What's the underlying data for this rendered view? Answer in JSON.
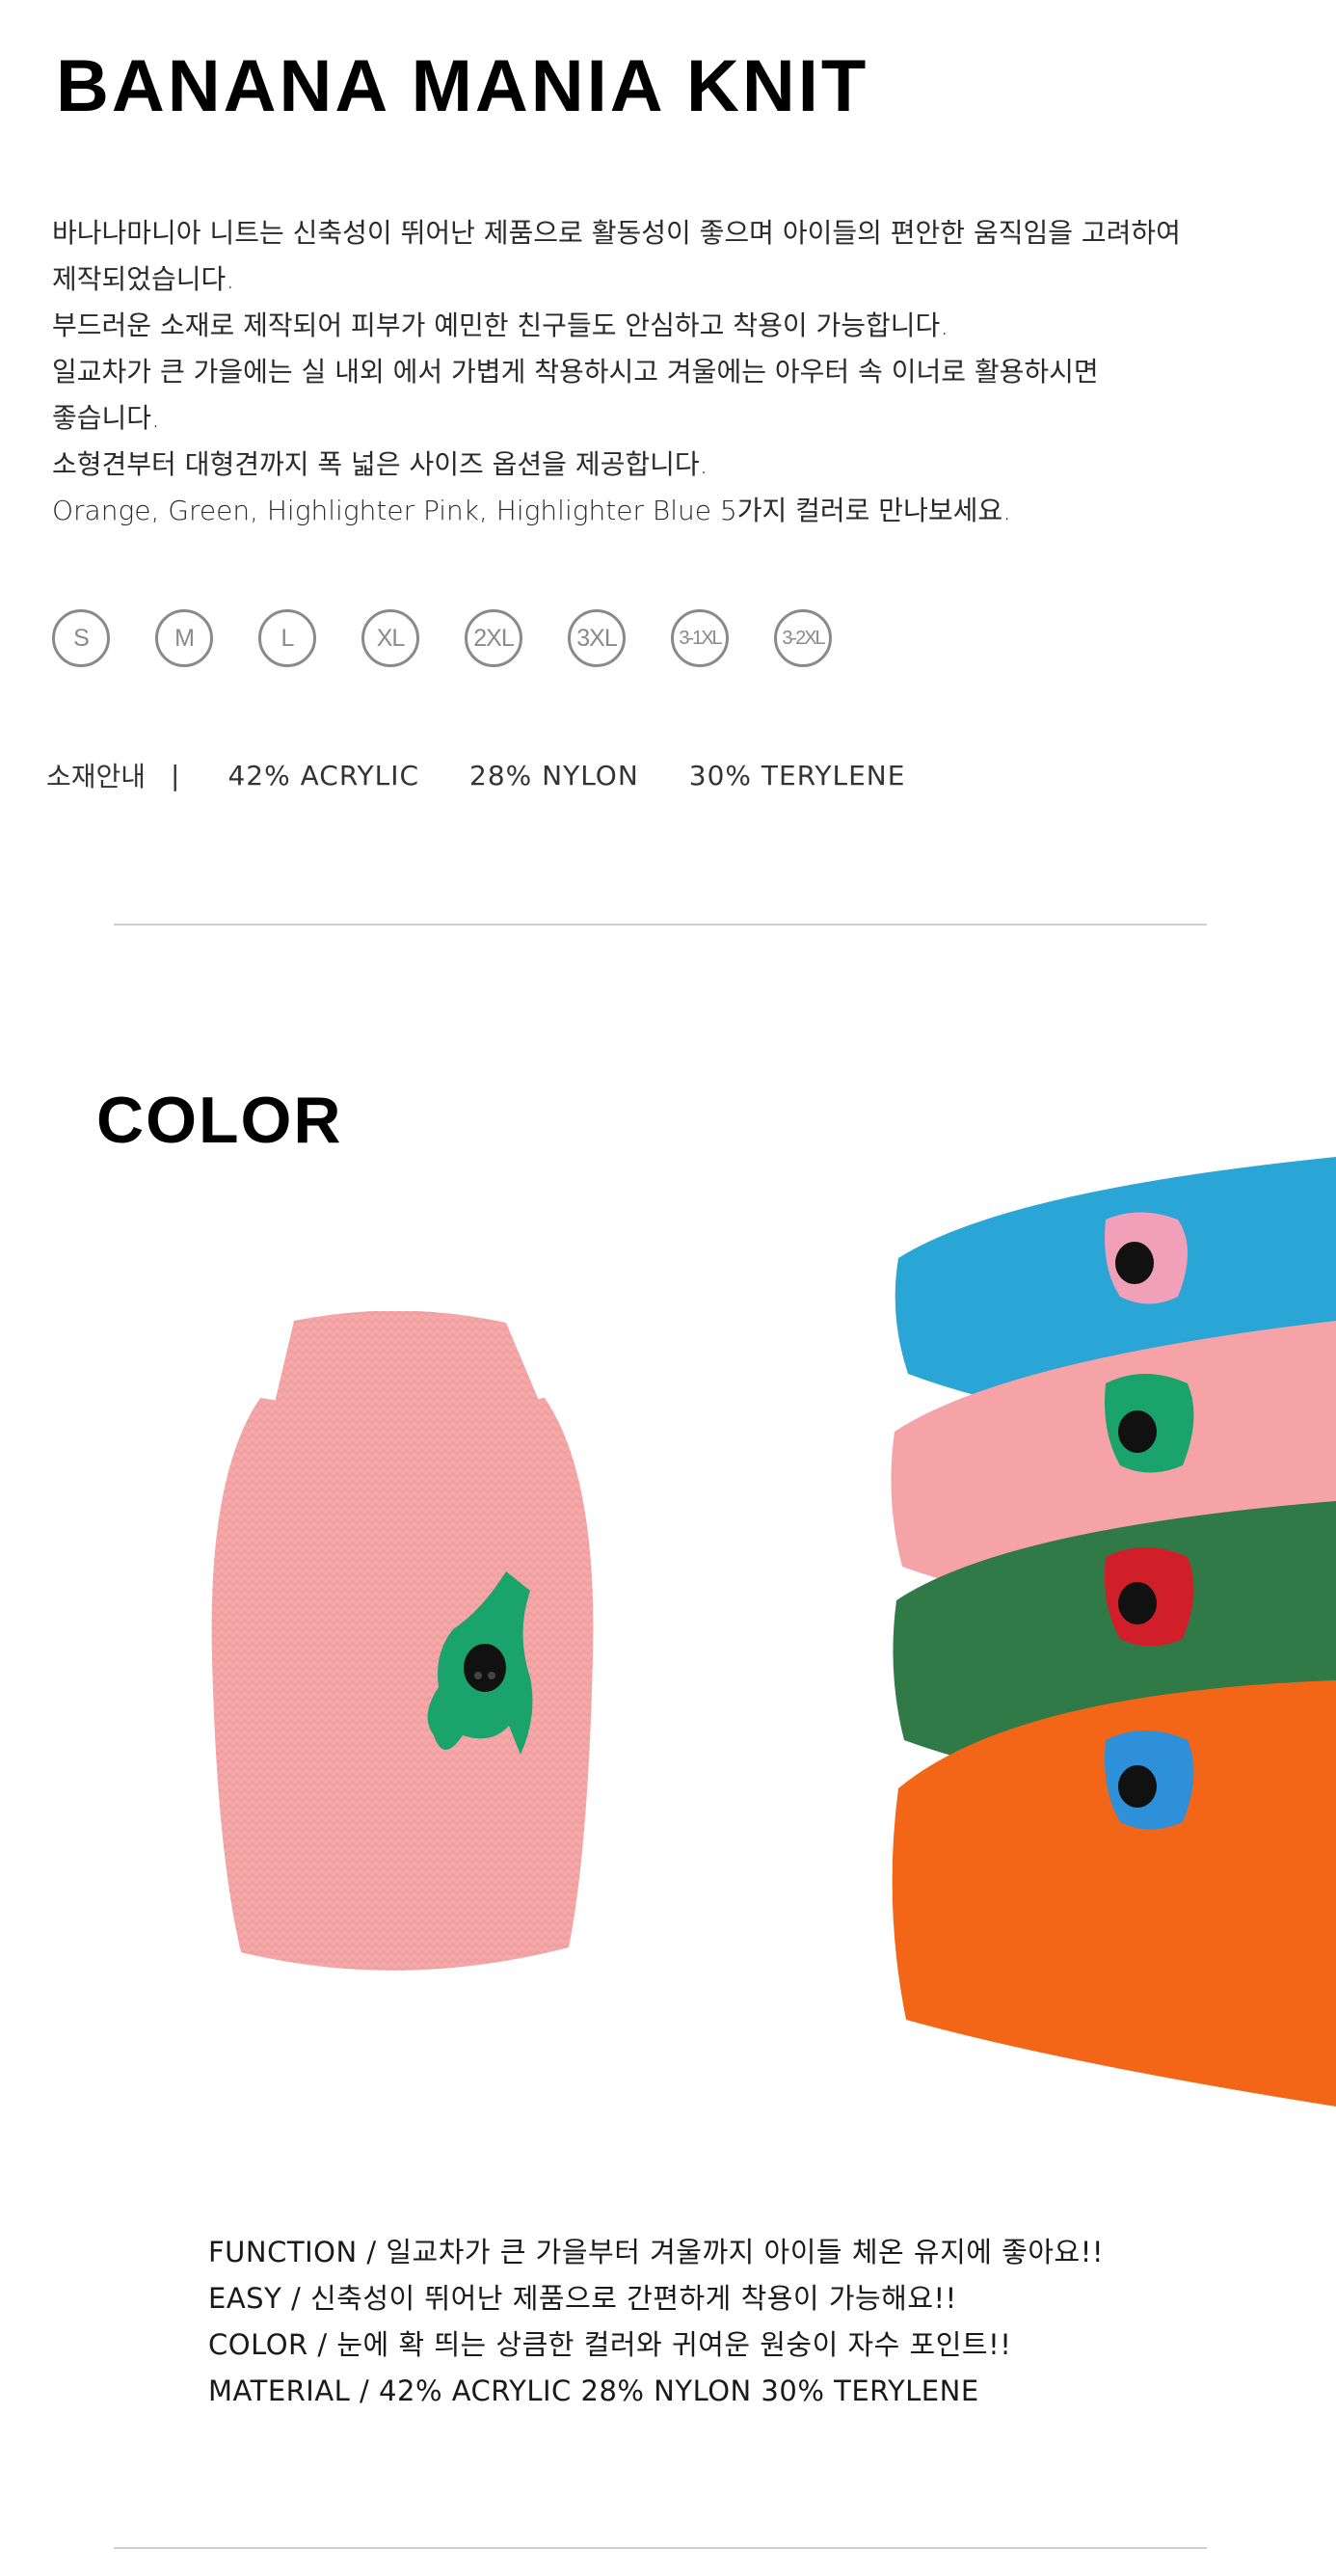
{
  "product": {
    "title": "BANANA MANIA KNIT",
    "description": [
      "바나나마니아 니트는 신축성이 뛰어난 제품으로 활동성이 좋으며 아이들의 편안한 움직임을 고려하여",
      "제작되었습니다.",
      "부드러운 소재로 제작되어 피부가 예민한 친구들도 안심하고 착용이 가능합니다.",
      "일교차가 큰 가을에는 실 내외 에서 가볍게 착용하시고 겨울에는 아우터 속 이너로 활용하시면",
      "좋습니다.",
      "소형견부터 대형견까지 폭 넓은 사이즈 옵션을 제공합니다.",
      "Orange, Green, Highlighter Pink, Highlighter Blue  5가지 컬러로 만나보세요."
    ]
  },
  "sizes": [
    "S",
    "M",
    "L",
    "XL",
    "2XL",
    "3XL",
    "3-1XL",
    "3-2XL"
  ],
  "material": {
    "label": "소재안내",
    "separator": "|",
    "items": [
      "42% ACRYLIC",
      "28% NYLON",
      "30% TERYLENE"
    ]
  },
  "color_section": {
    "title": "COLOR",
    "main_color": "#f6a6a6",
    "stack_colors": [
      "#29a6d6",
      "#f5a3a6",
      "#2f7a46",
      "#f46617"
    ]
  },
  "features": [
    "FUNCTION / 일교차가 큰 가을부터 겨울까지 아이들 체온 유지에 좋아요!!",
    "EASY / 신축성이 뛰어난 제품으로 간편하게 착용이 가능해요!!",
    "COLOR / 눈에 확 띄는 상큼한 컬러와 귀여운 원숭이 자수 포인트!!",
    "MATERIAL /   42% ACRYLIC     28% NYLON     30% TERYLENE"
  ]
}
